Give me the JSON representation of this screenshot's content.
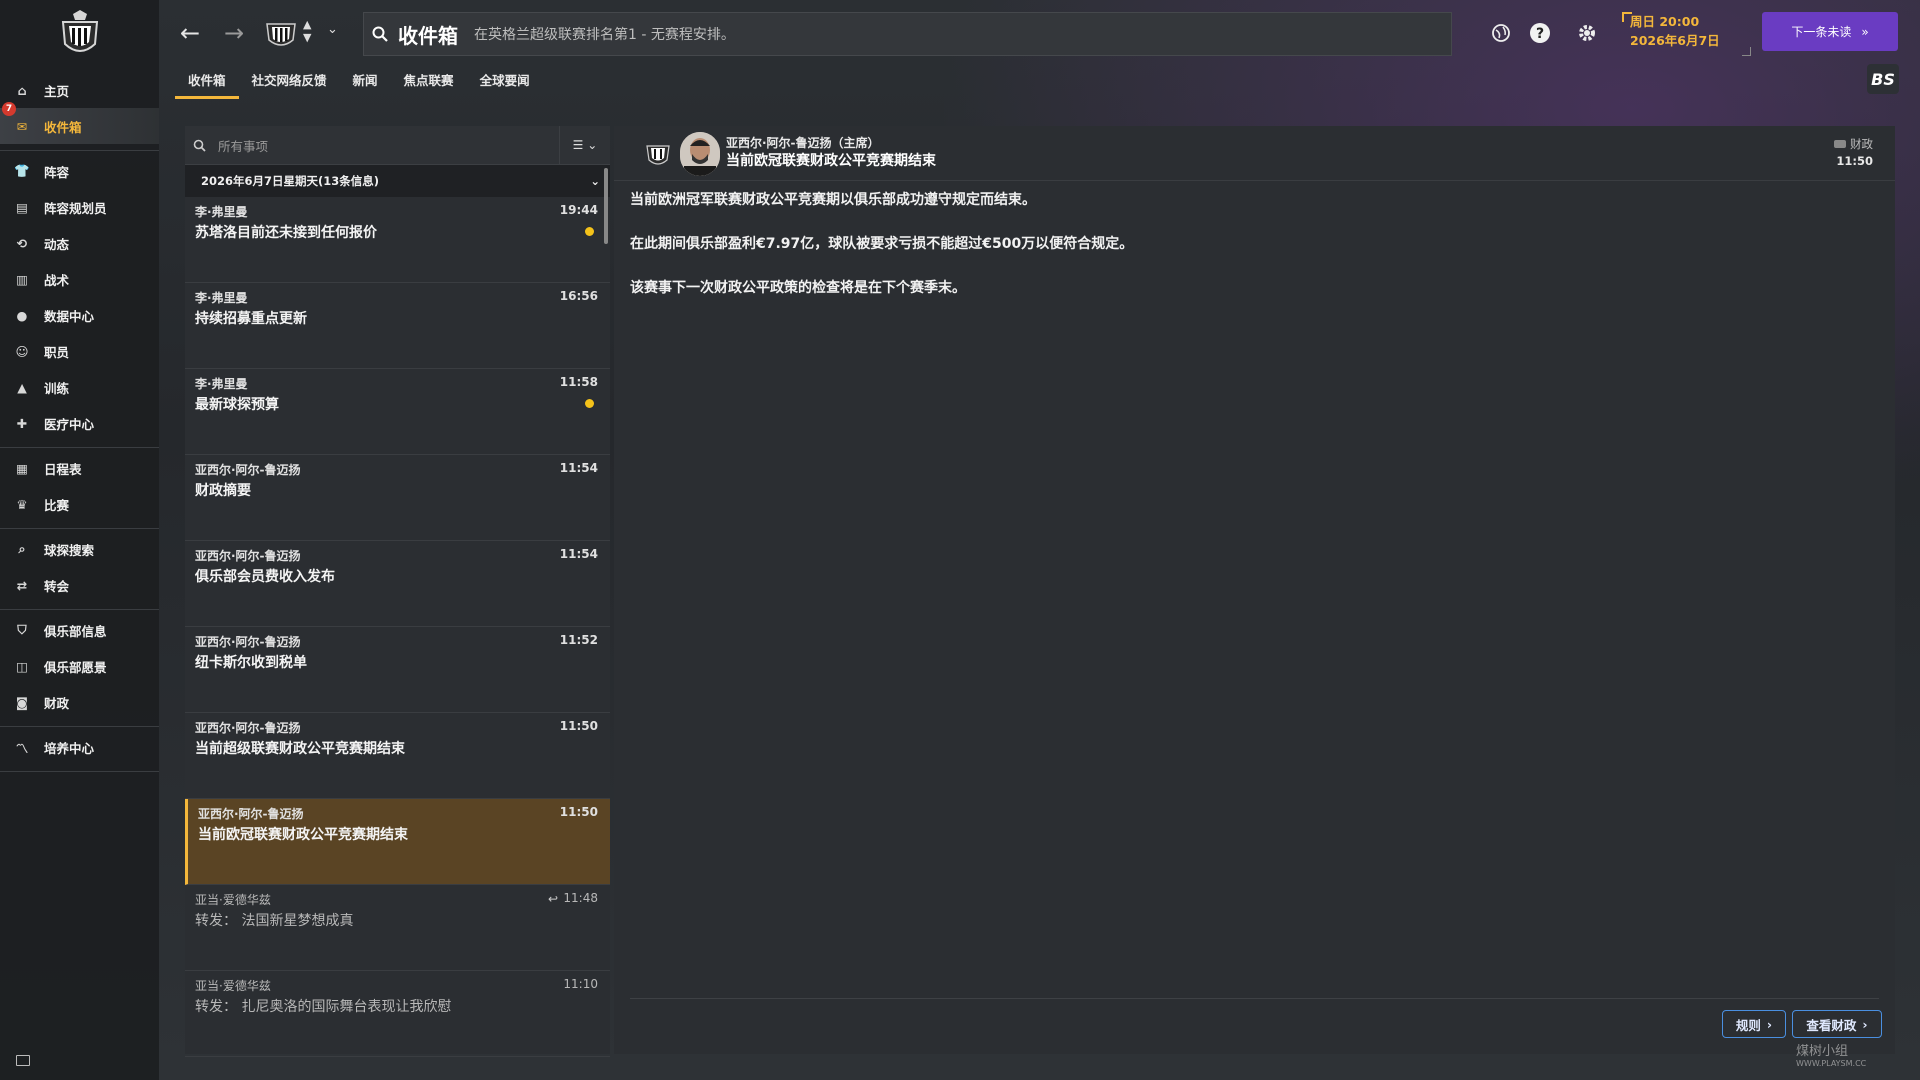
{
  "topbar": {
    "title": "收件箱",
    "status": "在英格兰超级联赛排名第1 - 无赛程安排。",
    "date_line1": "周日 20:00",
    "date_line2": "2026年6月7日",
    "continue_label": "下一条未读",
    "logo_text": "BS"
  },
  "sidebar": {
    "badge_count": "7",
    "groups": [
      [
        {
          "label": "主页",
          "icon": "home-icon"
        },
        {
          "label": "收件箱",
          "icon": "inbox-icon"
        }
      ],
      [
        {
          "label": "阵容",
          "icon": "shirt-icon"
        },
        {
          "label": "阵容规划员",
          "icon": "clipboard-icon"
        },
        {
          "label": "动态",
          "icon": "dynamics-icon"
        },
        {
          "label": "战术",
          "icon": "tactics-icon"
        },
        {
          "label": "数据中心",
          "icon": "data-hub-icon"
        },
        {
          "label": "职员",
          "icon": "staff-icon"
        },
        {
          "label": "训练",
          "icon": "training-icon"
        },
        {
          "label": "医疗中心",
          "icon": "medical-icon"
        }
      ],
      [
        {
          "label": "日程表",
          "icon": "calendar-icon"
        },
        {
          "label": "比赛",
          "icon": "trophy-icon"
        }
      ],
      [
        {
          "label": "球探搜索",
          "icon": "scout-search-icon"
        },
        {
          "label": "转会",
          "icon": "transfer-icon"
        }
      ],
      [
        {
          "label": "俱乐部信息",
          "icon": "shield-icon"
        },
        {
          "label": "俱乐部愿景",
          "icon": "vision-icon"
        },
        {
          "label": "财政",
          "icon": "finance-icon"
        }
      ],
      [
        {
          "label": "培养中心",
          "icon": "development-icon"
        }
      ]
    ]
  },
  "tabs": [
    "收件箱",
    "社交网络反馈",
    "新闻",
    "焦点联赛",
    "全球要闻"
  ],
  "list": {
    "search_placeholder": "所有事项",
    "date_header": "2026年6月7日星期天(13条信息)",
    "messages": [
      {
        "sender": "李·弗里曼",
        "time": "19:44",
        "subject": "苏塔洛目前还未接到任何报价",
        "unread": true
      },
      {
        "sender": "李·弗里曼",
        "time": "16:56",
        "subject": "持续招募重点更新",
        "unread": false
      },
      {
        "sender": "李·弗里曼",
        "time": "11:58",
        "subject": "最新球探预算",
        "unread": true
      },
      {
        "sender": "亚西尔·阿尔-鲁迈扬",
        "time": "11:54",
        "subject": "财政摘要",
        "unread": false
      },
      {
        "sender": "亚西尔·阿尔-鲁迈扬",
        "time": "11:54",
        "subject": "俱乐部会员费收入发布",
        "unread": false
      },
      {
        "sender": "亚西尔·阿尔-鲁迈扬",
        "time": "11:52",
        "subject": "纽卡斯尔收到税单",
        "unread": false
      },
      {
        "sender": "亚西尔·阿尔-鲁迈扬",
        "time": "11:50",
        "subject": "当前超级联赛财政公平竞赛期结束",
        "unread": false
      },
      {
        "sender": "亚西尔·阿尔-鲁迈扬",
        "time": "11:50",
        "subject": "当前欧冠联赛财政公平竞赛期结束",
        "unread": false,
        "selected": true
      },
      {
        "sender": "亚当·爱德华兹",
        "time": "11:48",
        "subject": "转发： 法国新星梦想成真",
        "unread": false,
        "read": true,
        "replied": true
      },
      {
        "sender": "亚当·爱德华兹",
        "time": "11:10",
        "subject": "转发： 扎尼奥洛的国际舞台表现让我欣慰",
        "unread": false,
        "read": true
      }
    ]
  },
  "detail": {
    "sender": "亚西尔·阿尔-鲁迈扬（主席）",
    "subject": "当前欧冠联赛财政公平竞赛期结束",
    "category": "财政",
    "time": "11:50",
    "paragraphs": [
      "当前欧洲冠军联赛财政公平竞赛期以俱乐部成功遵守规定而结束。",
      "在此期间俱乐部盈利€7.97亿，球队被要求亏损不能超过€500万以便符合规定。",
      "该赛事下一次财政公平政策的检查将是在下个赛季末。"
    ],
    "btn_rules": "规则",
    "btn_finance": "查看财政"
  },
  "watermark": {
    "line1": "煤树小组",
    "line2": "WWW.PLAYSM.CC"
  },
  "colors": {
    "accent": "#f4b73b",
    "continue": "#6a3cc2",
    "selected": "#5a4424",
    "unread_dot": "#f4c21a",
    "link_border": "#4a8fe0"
  }
}
